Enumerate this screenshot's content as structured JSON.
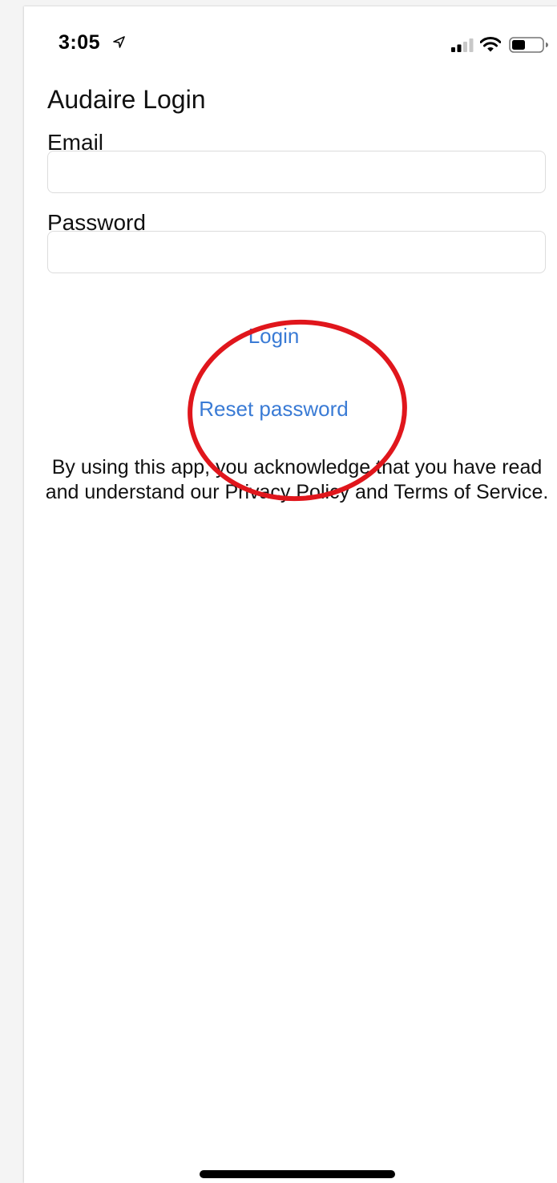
{
  "status_bar": {
    "time": "3:05",
    "icons": [
      "location-arrow-icon",
      "cellular-signal-icon",
      "wifi-icon",
      "battery-icon"
    ]
  },
  "login_screen": {
    "title": "Audaire Login",
    "email_label": "Email",
    "email_value": "",
    "password_label": "Password",
    "password_value": "",
    "login_label": "Login",
    "reset_label": "Reset password",
    "disclaimer": "By using this app, you acknowledge that you have read and understand our Privacy Policy and Terms of Service."
  },
  "colors": {
    "link": "#3a7bd5",
    "annotation": "#e0161c",
    "text": "#111111"
  }
}
